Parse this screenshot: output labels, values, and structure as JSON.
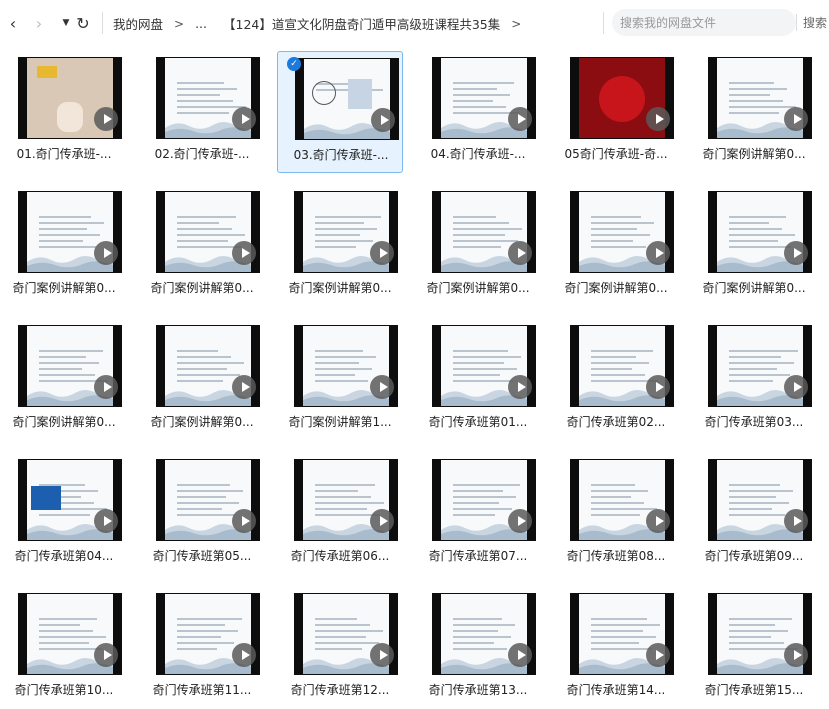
{
  "nav": {
    "back_glyph": "‹",
    "forward_glyph": "›",
    "dropdown_glyph": "▼",
    "refresh_glyph": "↻"
  },
  "breadcrumbs": [
    "我的网盘",
    "...",
    "【124】道宣文化阴盘奇门遁甲高级班课程共35集"
  ],
  "breadcrumb_separator": ">",
  "search": {
    "placeholder": "搜索我的网盘文件",
    "button": "搜索"
  },
  "files": [
    {
      "name": "01.奇门传承班-...",
      "thumb": "hand",
      "selected": false
    },
    {
      "name": "02.奇门传承班-...",
      "thumb": "slide",
      "selected": false
    },
    {
      "name": "03.奇门传承班-...",
      "thumb": "diagram",
      "selected": true
    },
    {
      "name": "04.奇门传承班-...",
      "thumb": "slide",
      "selected": false
    },
    {
      "name": "05奇门传承班-奇...",
      "thumb": "red",
      "selected": false
    },
    {
      "name": "奇门案例讲解第0...",
      "thumb": "slide",
      "selected": false
    },
    {
      "name": "奇门案例讲解第0...",
      "thumb": "slide",
      "selected": false
    },
    {
      "name": "奇门案例讲解第0...",
      "thumb": "slide",
      "selected": false
    },
    {
      "name": "奇门案例讲解第0...",
      "thumb": "slide",
      "selected": false
    },
    {
      "name": "奇门案例讲解第0...",
      "thumb": "slide",
      "selected": false
    },
    {
      "name": "奇门案例讲解第0...",
      "thumb": "slide",
      "selected": false
    },
    {
      "name": "奇门案例讲解第0...",
      "thumb": "slide",
      "selected": false
    },
    {
      "name": "奇门案例讲解第0...",
      "thumb": "slide",
      "selected": false
    },
    {
      "name": "奇门案例讲解第0...",
      "thumb": "slide",
      "selected": false
    },
    {
      "name": "奇门案例讲解第1...",
      "thumb": "slide",
      "selected": false
    },
    {
      "name": "奇门传承班第01...",
      "thumb": "slide",
      "selected": false
    },
    {
      "name": "奇门传承班第02...",
      "thumb": "slide",
      "selected": false
    },
    {
      "name": "奇门传承班第03...",
      "thumb": "slide",
      "selected": false
    },
    {
      "name": "奇门传承班第04...",
      "thumb": "flag",
      "selected": false
    },
    {
      "name": "奇门传承班第05...",
      "thumb": "slide",
      "selected": false
    },
    {
      "name": "奇门传承班第06...",
      "thumb": "slide",
      "selected": false
    },
    {
      "name": "奇门传承班第07...",
      "thumb": "slide",
      "selected": false
    },
    {
      "name": "奇门传承班第08...",
      "thumb": "slide",
      "selected": false
    },
    {
      "name": "奇门传承班第09...",
      "thumb": "slide",
      "selected": false
    },
    {
      "name": "奇门传承班第10...",
      "thumb": "slide",
      "selected": false
    },
    {
      "name": "奇门传承班第11...",
      "thumb": "slide",
      "selected": false
    },
    {
      "name": "奇门传承班第12...",
      "thumb": "slide",
      "selected": false
    },
    {
      "name": "奇门传承班第13...",
      "thumb": "slide",
      "selected": false
    },
    {
      "name": "奇门传承班第14...",
      "thumb": "slide",
      "selected": false
    },
    {
      "name": "奇门传承班第15...",
      "thumb": "slide",
      "selected": false
    }
  ],
  "colors": {
    "selected_bg": "#e6f2fd",
    "selected_border": "#7cb9ee",
    "check": "#1a7bdc",
    "slide_title": "#2a5a8a"
  }
}
